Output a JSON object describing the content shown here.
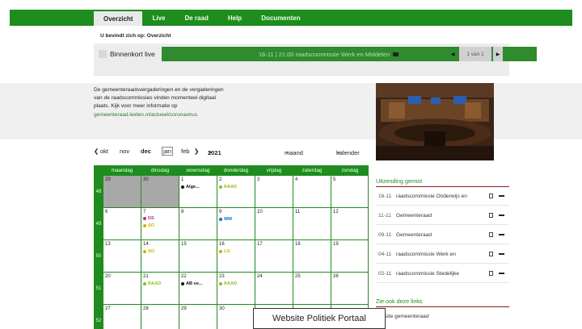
{
  "nav": {
    "tabs": [
      "Overzicht",
      "Live",
      "De raad",
      "Help",
      "Documenten"
    ]
  },
  "breadcrumb": {
    "text": "U bevindt zich op:  Overzicht"
  },
  "live": {
    "soon": "Binnenkort live",
    "ticker": "16-11 | 21:00 raadscommissie Werk en Middelen",
    "pager": "1 van 1"
  },
  "intro": {
    "text": "De gemeenteraadsvergaderingen en de vergaderingen van de raadscommissies vinden momenteel digitaal plaats. Kijk voor meer informatie op",
    "link": "gemeenteraad.leiden.nl/actueel/coronavirus."
  },
  "calendar": {
    "months": [
      "okt",
      "nov",
      "dec",
      "jan",
      "feb"
    ],
    "year": "2021",
    "view": "maand",
    "type": "kalender",
    "days": [
      "maandag",
      "dinsdag",
      "woensdag",
      "donderdag",
      "vrijdag",
      "zaterdag",
      "zondag"
    ],
    "weeks": [
      {
        "num": "48",
        "dates": [
          "29",
          "30",
          "1",
          "2",
          "3",
          "4",
          "5"
        ]
      },
      {
        "num": "49",
        "dates": [
          "6",
          "7",
          "8",
          "9",
          "10",
          "11",
          "12"
        ]
      },
      {
        "num": "50",
        "dates": [
          "13",
          "14",
          "15",
          "16",
          "17",
          "18",
          "19"
        ]
      },
      {
        "num": "51",
        "dates": [
          "20",
          "21",
          "22",
          "23",
          "24",
          "25",
          "26"
        ]
      },
      {
        "num": "52",
        "dates": [
          "27",
          "28",
          "29",
          "30",
          "",
          "",
          ""
        ]
      }
    ],
    "events": {
      "w0d2": "Alge...",
      "w0d3": "RAAD",
      "w1d1a": "DS",
      "w1d1b": "SO",
      "w1d3": "WM",
      "w2d1": "SO",
      "w2d3": "LO",
      "w3d1": "RAAD",
      "w3d2": "AB ve...",
      "w3d3": "RAAD"
    },
    "colors": {
      "green": "#1e8c1e",
      "olive": "#8fbf1e",
      "pink": "#c0307a",
      "blue": "#1a6ec8",
      "yellow": "#c8b400",
      "black": "#111111"
    }
  },
  "missed": {
    "title": "Uitzending gemist",
    "items": [
      {
        "date": "16-11",
        "title": "raadscommissie Onderwijs en"
      },
      {
        "date": "11-11",
        "title": "Gemeenteraad"
      },
      {
        "date": "09-11",
        "title": "Gemeenteraad"
      },
      {
        "date": "04-11",
        "title": "raadscommissie Werk en"
      },
      {
        "date": "02-11",
        "title": "raadscommissie Stedelijke"
      }
    ]
  },
  "links": {
    "title": "Zie ook deze links",
    "first": "site gemeenteraad"
  },
  "overlay": {
    "text": "Website Politiek Portaal"
  }
}
